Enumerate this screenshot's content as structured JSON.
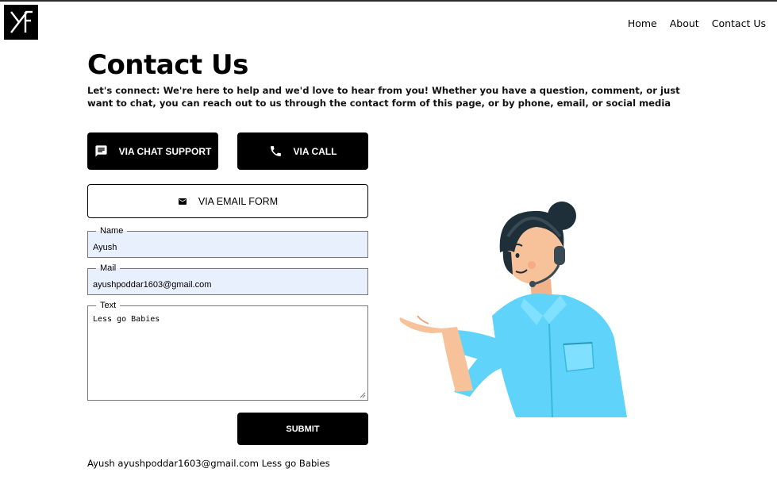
{
  "nav": {
    "logo_alt": "XF logo",
    "items": [
      {
        "label": "Home"
      },
      {
        "label": "About"
      },
      {
        "label": "Contact Us"
      }
    ]
  },
  "page": {
    "title": "Contact Us",
    "intro": "Let's connect: We're here to help and we'd love to hear from you! Whether you have a question, comment, or just want to chat, you can reach out to us through the contact form of this page, or by phone, email, or social media"
  },
  "buttons": {
    "chat": {
      "label": "VIA CHAT SUPPORT",
      "icon": "chat-icon"
    },
    "call": {
      "label": "VIA CALL",
      "icon": "phone-icon"
    },
    "email": {
      "label": "VIA EMAIL FORM",
      "icon": "mail-icon"
    },
    "submit": {
      "label": "SUBMIT"
    }
  },
  "form": {
    "name": {
      "legend": "Name",
      "value": "Ayush"
    },
    "mail": {
      "legend": "Mail",
      "value": "ayushpoddar1603@gmail.com"
    },
    "text": {
      "legend": "Text",
      "value": "Less go Babies"
    }
  },
  "echo": "Ayush ayushpoddar1603@gmail.com Less go Babies",
  "colors": {
    "accent": "#000000",
    "autofill_bg": "#e8f0fe",
    "shirt": "#5fd3f9",
    "hair": "#1f2f3a",
    "skin": "#f7c29a"
  }
}
